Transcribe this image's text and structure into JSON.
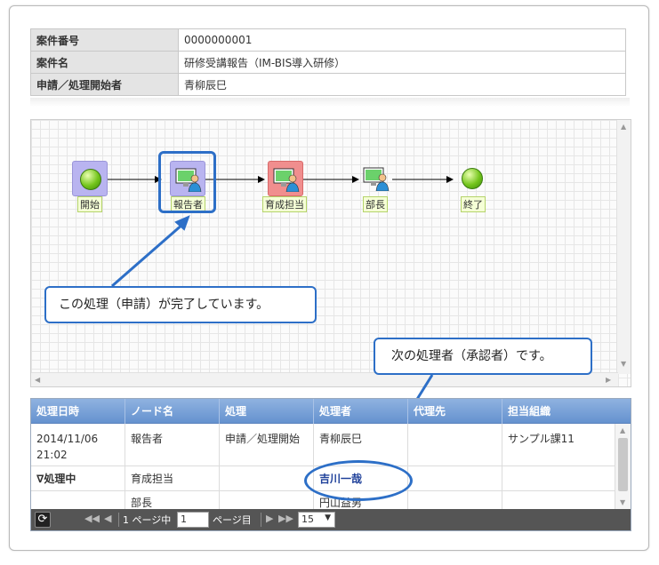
{
  "info": {
    "rows": [
      {
        "key": "案件番号",
        "value": "0000000001"
      },
      {
        "key": "案件名",
        "value": "研修受講報告（IM-BIS導入研修）"
      },
      {
        "key": "申請／処理開始者",
        "value": "青柳辰巳"
      }
    ]
  },
  "flow": {
    "nodes": {
      "start": "開始",
      "reporter": "報告者",
      "trainer": "育成担当",
      "manager": "部長",
      "end": "終了"
    }
  },
  "callouts": {
    "done": "この処理（申請）が完了しています。",
    "next": "次の処理者（承認者）です。"
  },
  "history": {
    "columns": [
      "処理日時",
      "ノード名",
      "処理",
      "処理者",
      "代理先",
      "担当組織"
    ],
    "rows": [
      {
        "date": "2014/11/06 21:02",
        "node": "報告者",
        "action": "申請／処理開始",
        "user": "青柳辰巳",
        "proxy": "",
        "org": "サンプル課11"
      },
      {
        "date": "∇処理中",
        "node": "育成担当",
        "action": "",
        "user": "吉川一哉",
        "proxy": "",
        "org": ""
      },
      {
        "date": "",
        "node": "部長",
        "action": "",
        "user": "円山益男",
        "proxy": "",
        "org": ""
      }
    ]
  },
  "pager": {
    "page_of": "1 ページ中",
    "page_value": "1",
    "page_suffix": "ページ目",
    "per_page": "15"
  },
  "colors": {
    "accent": "#2d6fc7",
    "header": "#6592cf"
  }
}
